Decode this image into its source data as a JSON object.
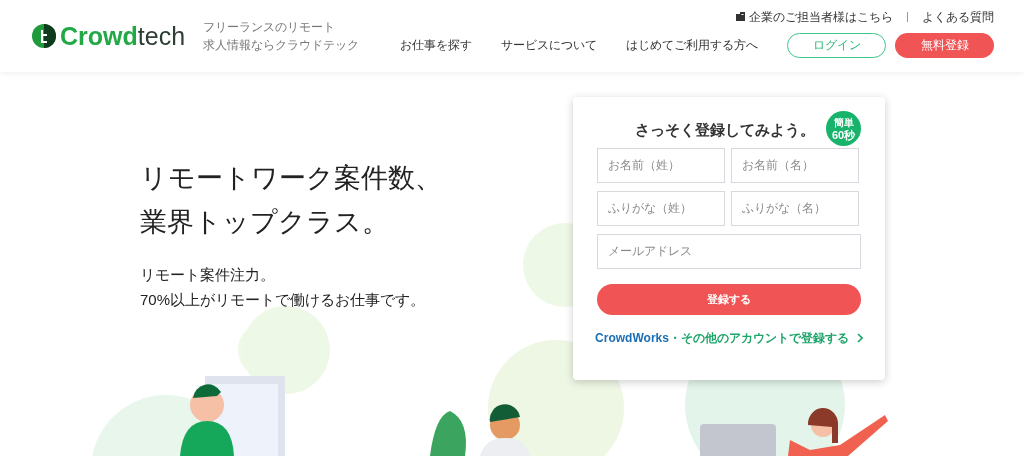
{
  "header": {
    "logo": {
      "brand_green": "Crowd",
      "brand_dark": "tech"
    },
    "tagline": [
      "フリーランスのリモート",
      "求人情報ならクラウドテック"
    ],
    "top_links": [
      "企業のご担当者様はこちら",
      "よくある質問"
    ],
    "nav": [
      "お仕事を探す",
      "サービスについて",
      "はじめてご利用する方へ"
    ],
    "login": "ログイン",
    "signup": "無料登録"
  },
  "hero": {
    "headline": [
      "リモートワーク案件数、",
      "業界トップクラス。"
    ],
    "subtext": [
      "リモート案件注力。",
      "70%以上がリモートで働けるお仕事です。"
    ]
  },
  "signup_form": {
    "title": "さっそく登録してみよう。",
    "badge": [
      "簡単",
      "60秒"
    ],
    "fields": [
      {
        "placeholder": "お名前（姓）",
        "kind": "half"
      },
      {
        "placeholder": "お名前（名）",
        "kind": "half"
      },
      {
        "placeholder": "ふりがな（姓）",
        "kind": "half"
      },
      {
        "placeholder": "ふりがな（名）",
        "kind": "half"
      },
      {
        "placeholder": "メールアドレス",
        "kind": "full"
      }
    ],
    "submit": "登録する",
    "alt_brand": "CrowdWorks",
    "alt_text": "・その他のアカウントで登録する"
  }
}
